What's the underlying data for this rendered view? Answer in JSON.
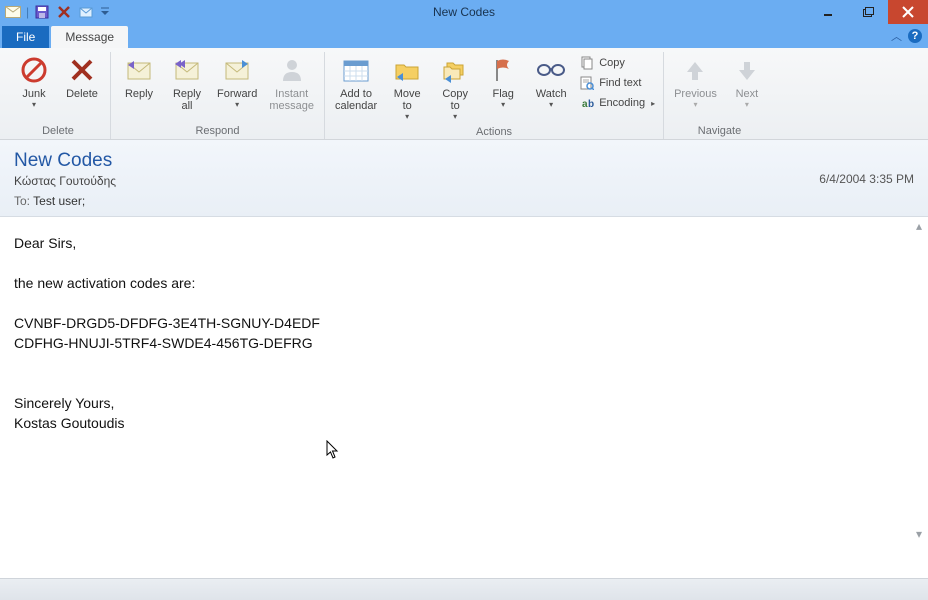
{
  "window": {
    "title": "New Codes"
  },
  "tabs": {
    "file": "File",
    "message": "Message"
  },
  "ribbon": {
    "delete_group": "Delete",
    "junk": "Junk",
    "delete": "Delete",
    "respond_group": "Respond",
    "reply": "Reply",
    "reply_all": "Reply\nall",
    "forward": "Forward",
    "instant_msg": "Instant\nmessage",
    "actions_group": "Actions",
    "add_calendar": "Add to\ncalendar",
    "move_to": "Move\nto",
    "copy_to": "Copy\nto",
    "flag": "Flag",
    "watch": "Watch",
    "copy": "Copy",
    "find_text": "Find text",
    "encoding": "Encoding",
    "navigate_group": "Navigate",
    "previous": "Previous",
    "next": "Next"
  },
  "help": "?",
  "message": {
    "subject": "New Codes",
    "from": "Κώστας Γουτούδης",
    "date": "6/4/2004 3:35 PM",
    "to_label": "To:",
    "to_value": "Test user;",
    "body_line1": "Dear Sirs,",
    "body_line2": "the new activation codes are:",
    "body_line3": "CVNBF-DRGD5-DFDFG-3E4TH-SGNUY-D4EDF",
    "body_line4": "CDFHG-HNUJI-5TRF4-SWDE4-456TG-DEFRG",
    "body_line5": "Sincerely Yours,",
    "body_line6": "Kostas Goutoudis"
  }
}
